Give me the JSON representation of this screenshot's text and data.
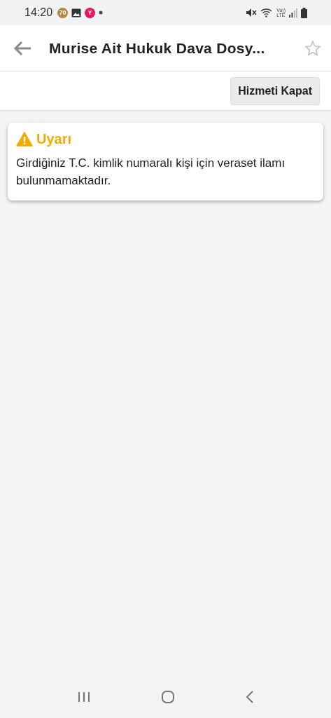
{
  "status_bar": {
    "time": "14:20",
    "badge": "70",
    "app_letter": "Y",
    "network_top": "Vo))",
    "network_bottom": "LTE"
  },
  "app_bar": {
    "title": "Murise Ait Hukuk Dava Dosy...",
    "favorite": false
  },
  "toolbar": {
    "buttons": [
      "Hizmeti Kapat"
    ]
  },
  "alert": {
    "kind": "warning",
    "title": "Uyarı",
    "message": "Girdiğiniz T.C. kimlik numaralı kişi için veraset ilamı bulunmamaktadır."
  }
}
